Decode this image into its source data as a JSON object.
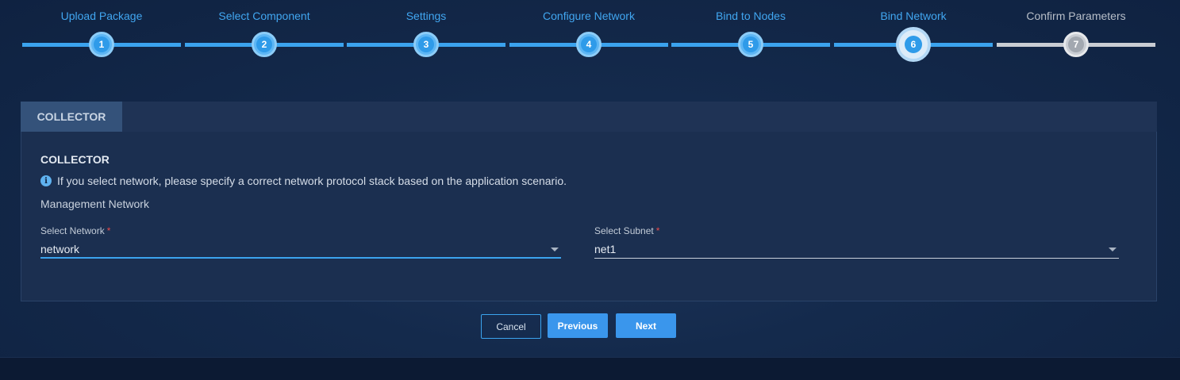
{
  "stepper": {
    "steps": [
      {
        "label": "Upload Package",
        "number": "1",
        "state": "done"
      },
      {
        "label": "Select Component",
        "number": "2",
        "state": "done"
      },
      {
        "label": "Settings",
        "number": "3",
        "state": "done"
      },
      {
        "label": "Configure Network",
        "number": "4",
        "state": "done"
      },
      {
        "label": "Bind to Nodes",
        "number": "5",
        "state": "done"
      },
      {
        "label": "Bind Network",
        "number": "6",
        "state": "current"
      },
      {
        "label": "Confirm Parameters",
        "number": "7",
        "state": "pending"
      }
    ]
  },
  "tabs": {
    "active_label": "COLLECTOR"
  },
  "section": {
    "title": "COLLECTOR",
    "info_icon": "info-icon",
    "info_text": "If you select network, please specify a correct network protocol stack based on the application scenario.",
    "network_group_label": "Management Network"
  },
  "fields": {
    "network": {
      "label": "Select Network",
      "required_mark": "*",
      "value": "network"
    },
    "subnet": {
      "label": "Select Subnet",
      "required_mark": "*",
      "value": "net1"
    }
  },
  "actions": {
    "cancel_label": "Cancel",
    "previous_label": "Previous",
    "next_label": "Next"
  },
  "colors": {
    "accent": "#3ba3ee",
    "background": "#142a4c",
    "panel": "#1b2f50",
    "required": "#ea4b4b",
    "pending": "#c9cdd3"
  }
}
